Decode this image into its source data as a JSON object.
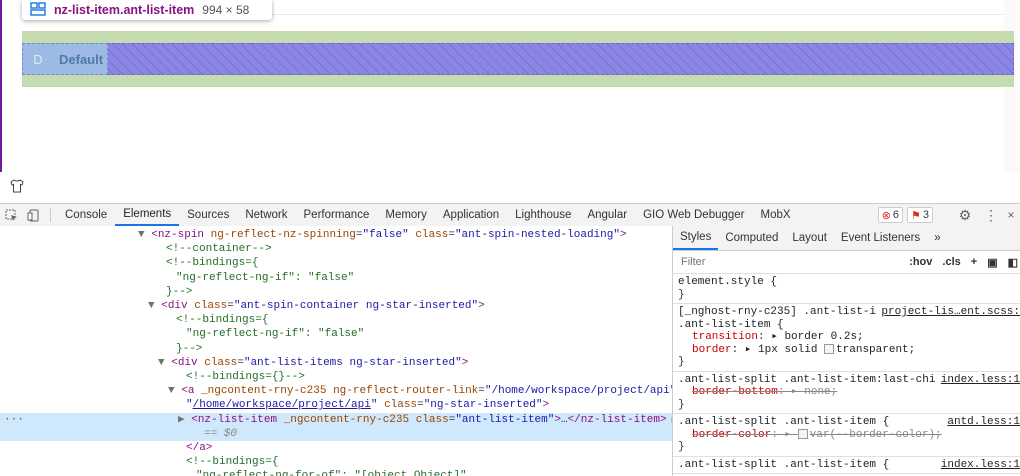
{
  "tooltip": {
    "selector": "nz-list-item.ant-list-item",
    "size": "994 × 58"
  },
  "list_item": {
    "avatar_letter": "D",
    "title": "Default"
  },
  "toolbar": {
    "tabs": [
      "Console",
      "Elements",
      "Sources",
      "Network",
      "Performance",
      "Memory",
      "Application",
      "Lighthouse",
      "Angular",
      "GIO Web Debugger",
      "MobX"
    ],
    "active_tab": "Elements",
    "errors": "6",
    "warnings": "3"
  },
  "dom": [
    {
      "indent": 148,
      "tri": "▼",
      "html": "<span class='tagc'>&lt;nz-spin</span> <span class='attr'>ng-reflect-nz-spinning</span>=<span class='val'>\"false\"</span> <span class='attr'>class</span>=<span class='val'>\"ant-spin-nested-loading\"</span><span class='tagc'>&gt;</span>"
    },
    {
      "indent": 166,
      "html": "<span class='cmt'>&lt;!--container--&gt;</span>"
    },
    {
      "indent": 166,
      "html": "<span class='cmt'>&lt;!--bindings={</span>"
    },
    {
      "indent": 176,
      "html": "<span class='cmt'>\"ng-reflect-ng-if\": \"false\"</span>"
    },
    {
      "indent": 166,
      "html": "<span class='cmt'>}--&gt;</span>"
    },
    {
      "indent": 158,
      "tri": "▼",
      "html": "<span class='tagc'>&lt;div</span> <span class='attr'>class</span>=<span class='val'>\"ant-spin-container ng-star-inserted\"</span><span class='tagc'>&gt;</span>"
    },
    {
      "indent": 176,
      "html": "<span class='cmt'>&lt;!--bindings={</span>"
    },
    {
      "indent": 186,
      "html": "<span class='cmt'>\"ng-reflect-ng-if\": \"false\"</span>"
    },
    {
      "indent": 176,
      "html": "<span class='cmt'>}--&gt;</span>"
    },
    {
      "indent": 168,
      "tri": "▼",
      "html": "<span class='tagc'>&lt;div</span> <span class='attr'>class</span>=<span class='val'>\"ant-list-items ng-star-inserted\"</span><span class='tagc'>&gt;</span>"
    },
    {
      "indent": 186,
      "html": "<span class='cmt'>&lt;!--bindings={}--&gt;</span>"
    },
    {
      "indent": 178,
      "tri": "▼",
      "html": "<span class='tagc'>&lt;a</span> <span class='attr'>_ngcontent-rny-c235</span> <span class='attr'>ng-reflect-router-link</span>=<span class='val'>\"/home/workspace/project/api\"</span> <span class='attr'>href</span>="
    },
    {
      "indent": 186,
      "html": "<span class='val'>\"</span><span class='link'>/home/workspace/project/api</span><span class='val'>\"</span> <span class='attr'>class</span>=<span class='val'>\"ng-star-inserted\"</span><span class='tagc'>&gt;</span>"
    },
    {
      "indent": 188,
      "tri": "▶",
      "sel": true,
      "html": "<span class='tagc'>&lt;nz-list-item</span> <span class='attr'>_ngcontent-rny-c235</span> <span class='attr'>class</span>=<span class='val'>\"ant-list-item\"</span><span class='tagc'>&gt;</span>…<span class='tagc'>&lt;/nz-list-item&gt;</span><span class='flexb'>flex</span>"
    },
    {
      "indent": 204,
      "sel": true,
      "html": "<span class='dollar'>== $0</span>"
    },
    {
      "indent": 186,
      "html": "<span class='tagc'>&lt;/a&gt;</span>"
    },
    {
      "indent": 186,
      "html": "<span class='cmt'>&lt;!--bindings={</span>"
    },
    {
      "indent": 196,
      "html": "<span class='cmt'>\"ng-reflect-ng-for-of\": \"[object Object]\"</span>"
    }
  ],
  "styles": {
    "tabs": [
      "Styles",
      "Computed",
      "Layout",
      "Event Listeners"
    ],
    "active_tab": "Styles",
    "more": "»",
    "filter_placeholder": "Filter",
    "hov": ":hov",
    "cls": ".cls",
    "rules": [
      {
        "selector": "element.style {",
        "close": "}",
        "props": []
      },
      {
        "selector": "[_nghost-rny-c235] .ant-list-items",
        "selector2": ".ant-list-item {",
        "source": "project-lis…ent.scss:",
        "props": [
          {
            "name": "transition",
            "value": "▸ border 0.2s;"
          },
          {
            "name": "border",
            "value": "▸ 1px solid ",
            "swatch": true,
            "value2": "transparent;"
          }
        ],
        "close": "}"
      },
      {
        "selector": ".ant-list-split .ant-list-item:last-child {",
        "source": "index.less:1",
        "props": [
          {
            "name": "border-bottom",
            "value": "▸ none;",
            "strike": true
          }
        ],
        "close": "}"
      },
      {
        "selector": ".ant-list-split .ant-list-item {",
        "source": "antd.less:1",
        "props": [
          {
            "name": "border-color",
            "value": "▸ ",
            "swatch": true,
            "value2": "var(--border-color);",
            "strike": true
          }
        ],
        "close": "}"
      },
      {
        "selector": ".ant-list-split .ant-list-item {",
        "source": "index.less:1",
        "props": []
      }
    ]
  }
}
